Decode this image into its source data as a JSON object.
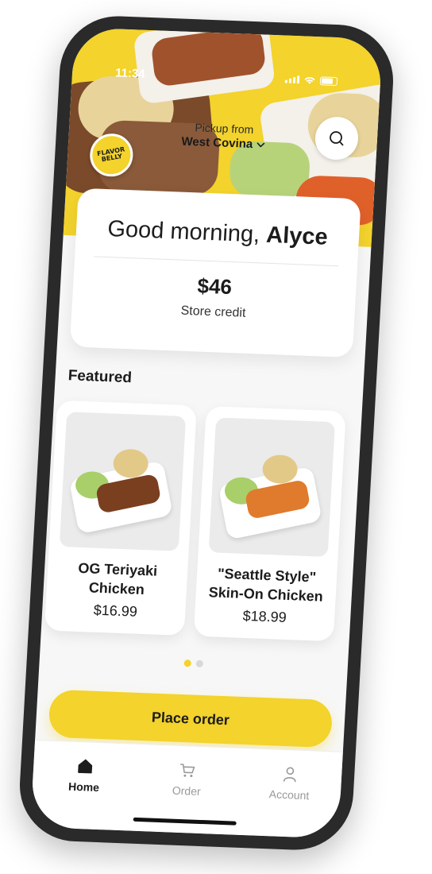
{
  "status_bar": {
    "time": "11:34"
  },
  "brand": {
    "logo_text": "FLAVOR BELLY",
    "accent": "#f3d32c"
  },
  "header": {
    "pickup_label": "Pickup from",
    "pickup_location": "West Covina"
  },
  "greeting_card": {
    "greeting_prefix": "Good morning, ",
    "user_name": "Alyce",
    "credit_amount": "$46",
    "credit_label": "Store credit"
  },
  "featured": {
    "title": "Featured",
    "items": [
      {
        "name": "OG Teriyaki Chicken",
        "price": "$16.99"
      },
      {
        "name": "\"Seattle Style\" Skin-On Chicken",
        "price": "$18.99"
      }
    ],
    "active_page": 1,
    "page_count": 2
  },
  "cta": {
    "place_order": "Place order"
  },
  "tabbar": {
    "items": [
      {
        "label": "Home",
        "icon": "home-icon",
        "active": true
      },
      {
        "label": "Order",
        "icon": "cart-icon",
        "active": false
      },
      {
        "label": "Account",
        "icon": "user-icon",
        "active": false
      }
    ]
  }
}
